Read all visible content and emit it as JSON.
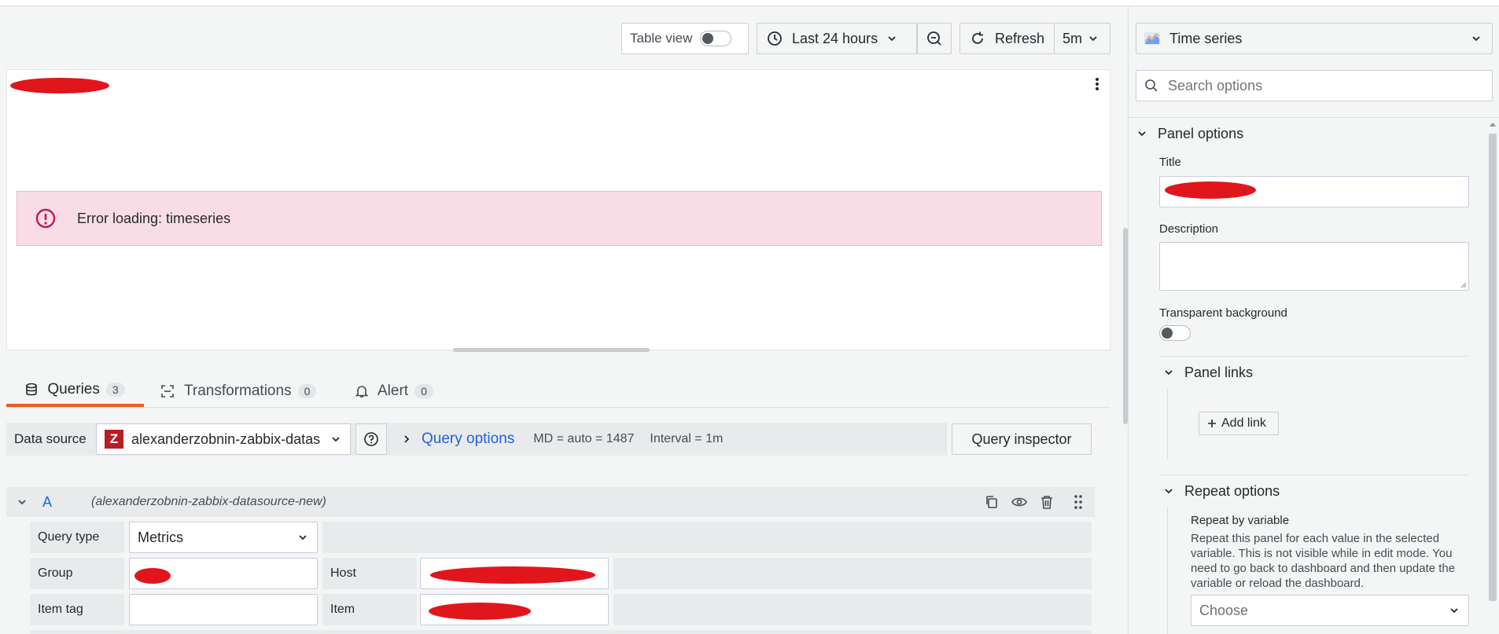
{
  "toolbar": {
    "table_view_label": "Table view",
    "time_range_label": "Last 24 hours",
    "refresh_label": "Refresh",
    "refresh_interval": "5m"
  },
  "panel": {
    "error_message": "Error loading: timeseries"
  },
  "tabs": [
    {
      "label": "Queries",
      "count": "3"
    },
    {
      "label": "Transformations",
      "count": "0"
    },
    {
      "label": "Alert",
      "count": "0"
    }
  ],
  "datasource_row": {
    "label": "Data source",
    "datasource_name": "alexanderzobnin-zabbix-datas",
    "datasource_logo_letter": "Z",
    "query_options_label": "Query options",
    "md_text": "MD = auto = 1487",
    "interval_text": "Interval = 1m",
    "query_inspector_label": "Query inspector"
  },
  "query_a": {
    "ref_id": "A",
    "datasource": "(alexanderzobnin-zabbix-datasource-new)",
    "query_type_label": "Query type",
    "query_type_value": "Metrics",
    "group_label": "Group",
    "host_label": "Host",
    "item_tag_label": "Item tag",
    "item_label": "Item"
  },
  "sidebar": {
    "visualization": "Time series",
    "search_placeholder": "Search options",
    "panel_options_header": "Panel options",
    "title_label": "Title",
    "description_label": "Description",
    "transparent_label": "Transparent background",
    "panel_links_header": "Panel links",
    "add_link_label": "Add link",
    "repeat_options_header": "Repeat options",
    "repeat_by_variable_label": "Repeat by variable",
    "repeat_description": "Repeat this panel for each value in the selected variable. This is not visible while in edit mode. You need to go back to dashboard and then update the variable or reload the dashboard.",
    "choose_placeholder": "Choose"
  },
  "colors": {
    "accent_orange": "#f05a28",
    "link_blue": "#1f62e0",
    "error_bg": "#f9dde6",
    "error_icon": "#c4165a"
  }
}
